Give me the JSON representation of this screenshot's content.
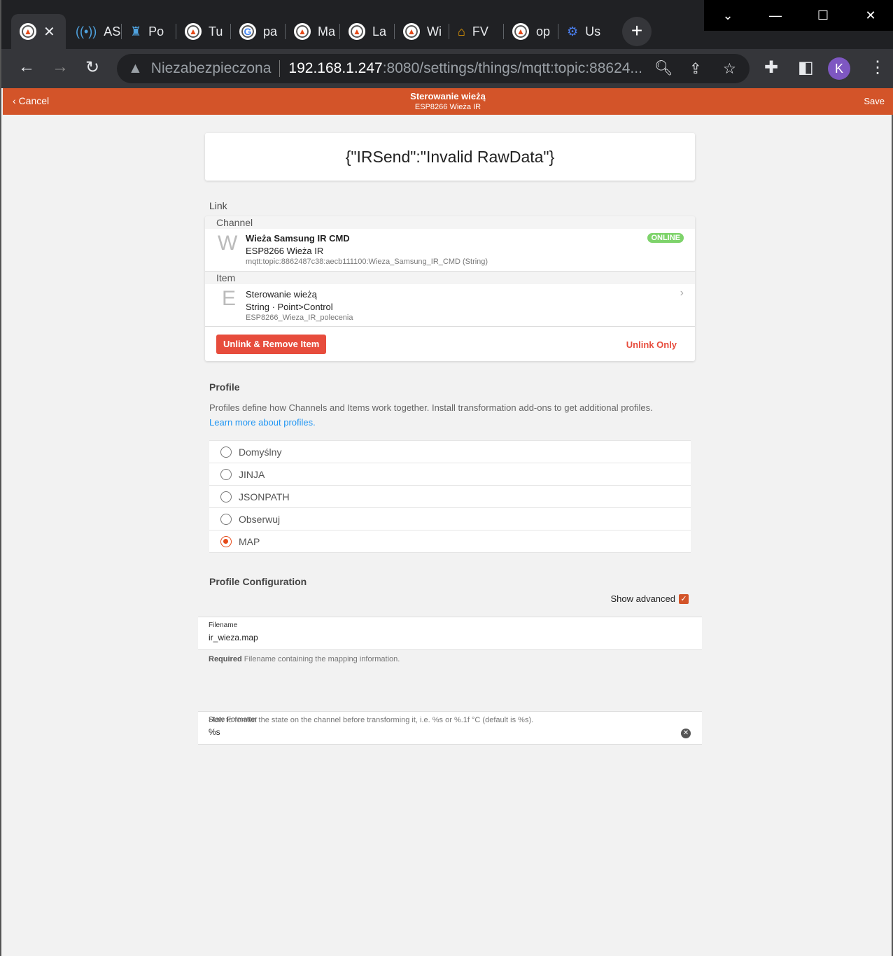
{
  "browser": {
    "tabs": [
      {
        "label": "",
        "icon": "openhab-icon"
      },
      {
        "label": "AS",
        "icon": "antenna-icon"
      },
      {
        "label": "Po",
        "icon": "robot-icon"
      },
      {
        "label": "Tu",
        "icon": "openhab-icon"
      },
      {
        "label": "pa",
        "icon": "google-icon"
      },
      {
        "label": "Ma",
        "icon": "openhab-icon"
      },
      {
        "label": "La",
        "icon": "openhab-icon"
      },
      {
        "label": "Wi",
        "icon": "openhab-icon"
      },
      {
        "label": "FV",
        "icon": "home-icon"
      },
      {
        "label": "op",
        "icon": "openhab-icon"
      },
      {
        "label": "Us",
        "icon": "gear-icon"
      }
    ],
    "security": "Niezabezpieczona",
    "url_host": "192.168.1.247",
    "url_rest": ":8080/settings/things/mqtt:topic:88624...",
    "profile_initial": "K"
  },
  "header": {
    "cancel": "Cancel",
    "title": "Sterowanie wieżą",
    "subtitle": "ESP8266 Wieża IR",
    "save": "Save"
  },
  "state_text": "{\"IRSend\":\"Invalid RawData\"}",
  "link": {
    "section": "Link",
    "channel_label": "Channel",
    "channel": {
      "initial": "W",
      "title": "Wieża Samsung IR CMD",
      "subtitle": "ESP8266 Wieża IR",
      "uid": "mqtt:topic:8862487c38:aecb111100:Wieza_Samsung_IR_CMD (String)",
      "badge": "ONLINE"
    },
    "item_label": "Item",
    "item": {
      "initial": "E",
      "title": "Sterowanie wieżą",
      "subtitle": "String · Point>Control",
      "name": "ESP8266_Wieza_IR_polecenia"
    },
    "unlink_remove": "Unlink & Remove Item",
    "unlink_only": "Unlink Only"
  },
  "profile": {
    "section": "Profile",
    "description": "Profiles define how Channels and Items work together. Install transformation add-ons to get additional profiles.",
    "learn_more": "Learn more about profiles.",
    "options": [
      "Domyślny",
      "JINJA",
      "JSONPATH",
      "Obserwuj",
      "MAP"
    ],
    "selected": "MAP"
  },
  "config": {
    "section": "Profile Configuration",
    "show_advanced": "Show advanced",
    "show_advanced_checked": true,
    "filename_label": "Filename",
    "filename_value": "ir_wieza.map",
    "filename_required": "Required",
    "filename_help": " Filename containing the mapping information.",
    "formatter_label": "State Formatter",
    "formatter_value": "%s",
    "formatter_help": "How to format the state on the channel before transforming it, i.e. %s or %.1f °C (default is %s)."
  },
  "colors": {
    "accent": "#d35429",
    "online": "#7ed36b",
    "danger": "#e74c3c"
  }
}
